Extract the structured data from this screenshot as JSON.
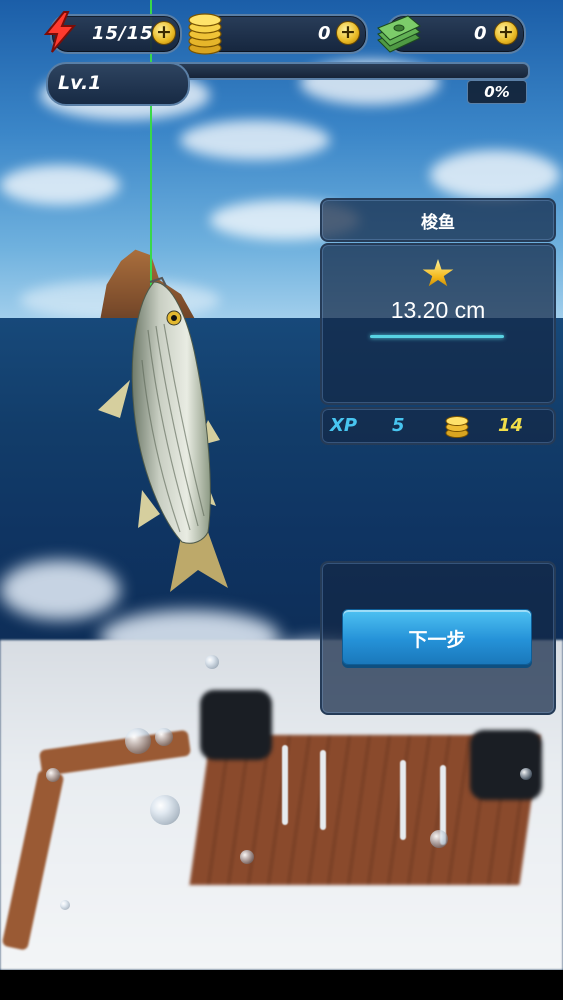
{
  "hud": {
    "energy": "15/15",
    "coins": "0",
    "cash": "0",
    "level_label": "Lv.1",
    "level_progress_percent": 0,
    "level_progress_label": "0%"
  },
  "catch": {
    "fish_name": "梭鱼",
    "size": "13.20 cm",
    "xp_label": "XP",
    "xp_value": "5",
    "coin_reward": "14"
  },
  "actions": {
    "next_label": "下一步"
  },
  "colors": {
    "panel_bg": "#142846",
    "button": "#2592d8",
    "xp_text": "#48c5f0",
    "coin_text": "#f1de4a",
    "fishing_line": "#39d84a"
  },
  "icons": [
    "lightning-icon",
    "coin-stack-icon",
    "cash-stack-icon",
    "plus-icon",
    "star-icon",
    "coin-icon"
  ]
}
